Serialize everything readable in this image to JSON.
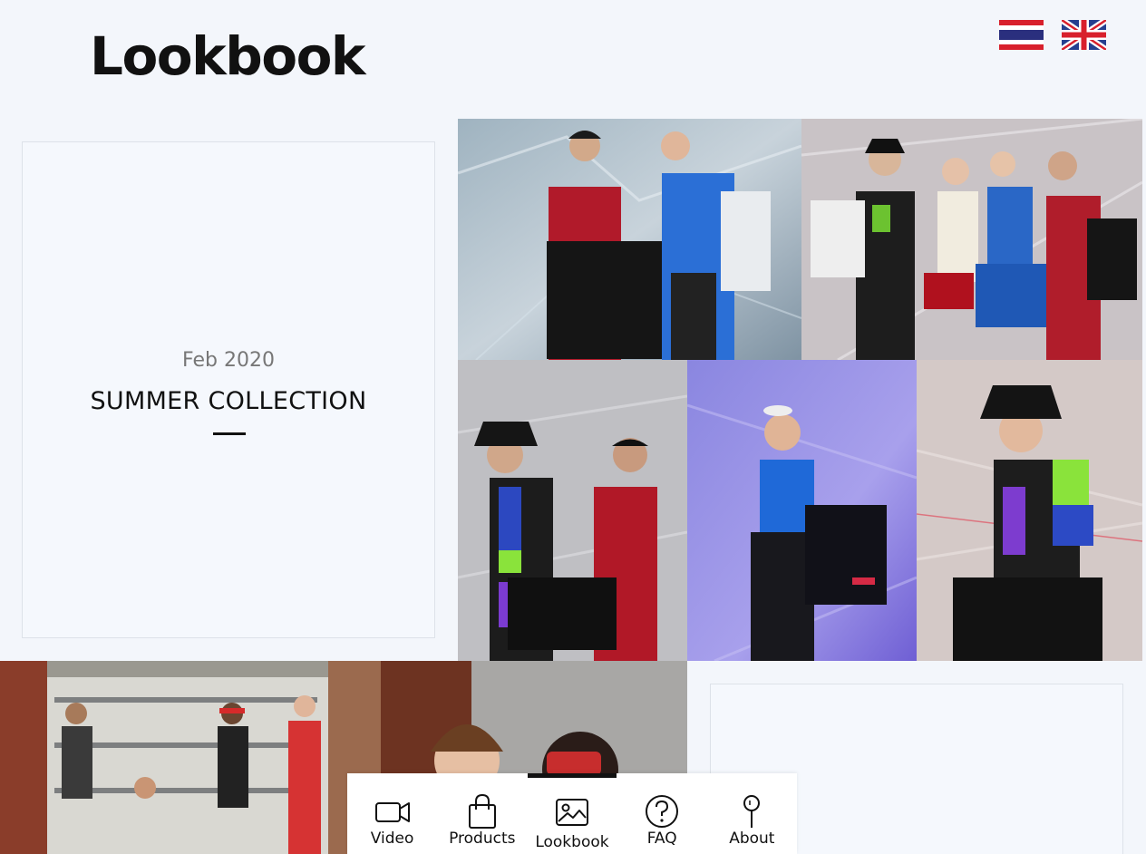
{
  "header": {
    "title": "Lookbook"
  },
  "languages": [
    {
      "code": "th",
      "icon": "thailand-flag-icon"
    },
    {
      "code": "en",
      "icon": "uk-flag-icon"
    }
  ],
  "collection_card": {
    "date": "Feb 2020",
    "title": "SUMMER COLLECTION"
  },
  "photos": [
    {
      "id": "lookbook-photo-1",
      "icon": "fashion-photo"
    },
    {
      "id": "lookbook-photo-2",
      "icon": "fashion-photo"
    },
    {
      "id": "lookbook-photo-3",
      "icon": "fashion-photo"
    },
    {
      "id": "lookbook-photo-4",
      "icon": "fashion-photo"
    },
    {
      "id": "lookbook-photo-5",
      "icon": "fashion-photo"
    },
    {
      "id": "lookbook-photo-6",
      "icon": "fashion-photo"
    }
  ],
  "bottom_nav": {
    "items": [
      {
        "label": "Video",
        "icon": "video-camera-icon"
      },
      {
        "label": "Products",
        "icon": "shopping-bag-icon"
      },
      {
        "label": "Lookbook",
        "icon": "image-icon",
        "active": true
      },
      {
        "label": "FAQ",
        "icon": "question-circle-icon"
      },
      {
        "label": "About",
        "icon": "pin-icon"
      }
    ]
  },
  "colors": {
    "background": "#f3f6fb",
    "text": "#111111",
    "muted": "#777777",
    "accent_red": "#d8202c",
    "accent_blue": "#2a4a9e"
  }
}
